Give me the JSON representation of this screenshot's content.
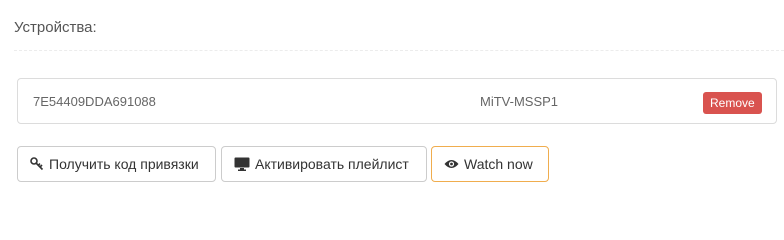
{
  "section": {
    "title": "Устройства:"
  },
  "device": {
    "id": "7E54409DDA691088",
    "name": "MiTV-MSSP1",
    "remove_label": "Remove"
  },
  "actions": {
    "get_code_label": "Получить код привязки",
    "activate_playlist_label": "Активировать плейлист",
    "watch_now_label": "Watch now"
  },
  "icons": {
    "get_code": "key-icon",
    "activate_playlist": "monitor-icon",
    "watch_now": "eye-icon"
  },
  "colors": {
    "remove_button": "#d9534f",
    "watch_border": "#f0ad4e"
  }
}
